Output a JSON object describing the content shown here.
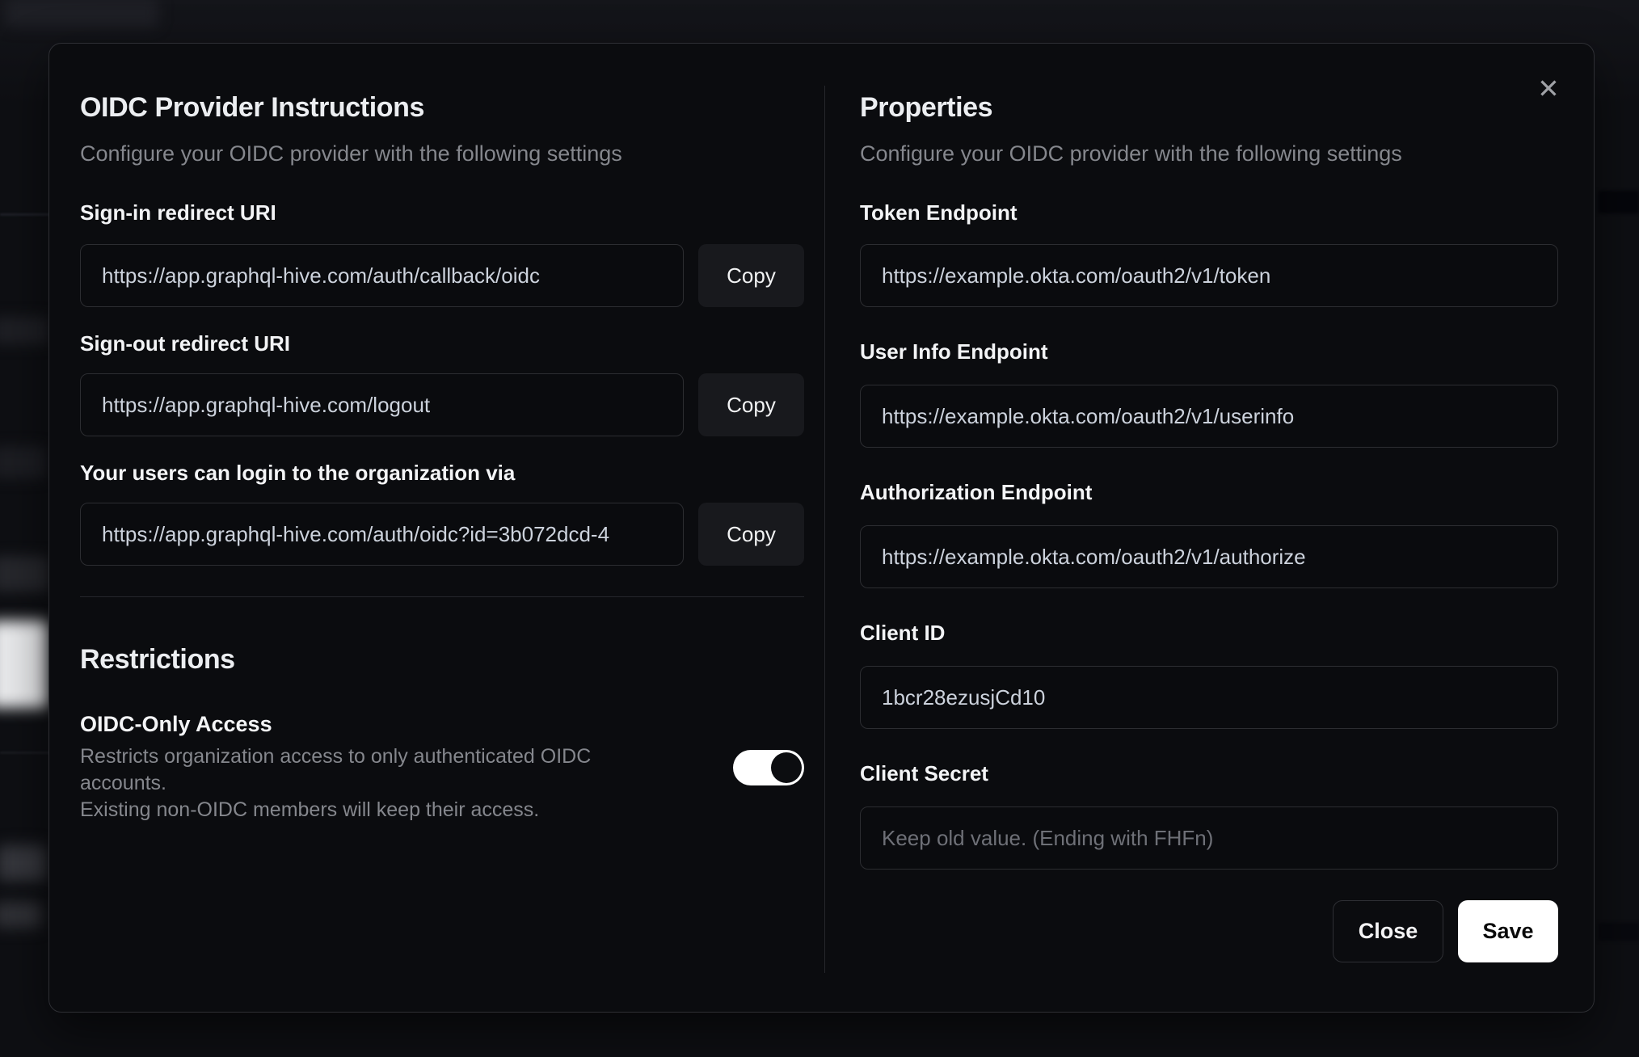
{
  "modal": {
    "close_icon": "✕",
    "left": {
      "title": "OIDC Provider Instructions",
      "subtitle": "Configure your OIDC provider with the following settings",
      "fields": [
        {
          "label": "Sign-in redirect URI",
          "value": "https://app.graphql-hive.com/auth/callback/oidc",
          "copy_label": "Copy"
        },
        {
          "label": "Sign-out redirect URI",
          "value": "https://app.graphql-hive.com/logout",
          "copy_label": "Copy"
        },
        {
          "label": "Your users can login to the organization via",
          "value": "https://app.graphql-hive.com/auth/oidc?id=3b072dcd-4",
          "copy_label": "Copy"
        }
      ],
      "restrictions": {
        "title": "Restrictions",
        "toggle_label": "OIDC-Only Access",
        "toggle_description_line1": "Restricts organization access to only authenticated OIDC accounts.",
        "toggle_description_line2": "Existing non-OIDC members will keep their access.",
        "toggle_state": "true"
      }
    },
    "right": {
      "title": "Properties",
      "subtitle": "Configure your OIDC provider with the following settings",
      "fields": [
        {
          "label": "Token Endpoint",
          "value": "https://example.okta.com/oauth2/v1/token"
        },
        {
          "label": "User Info Endpoint",
          "value": "https://example.okta.com/oauth2/v1/userinfo"
        },
        {
          "label": "Authorization Endpoint",
          "value": "https://example.okta.com/oauth2/v1/authorize"
        },
        {
          "label": "Client ID",
          "value": "1bcr28ezusjCd10"
        },
        {
          "label": "Client Secret",
          "placeholder": "Keep old value. (Ending with FHFn)"
        }
      ],
      "buttons": {
        "close": "Close",
        "save": "Save"
      }
    },
    "colors": {
      "modal_background": "#0b0c0f",
      "input_border": "#2c2d31",
      "toggle_on": "#ffffff",
      "save_button": "#ffffff",
      "muted_text": "#85878d"
    }
  }
}
